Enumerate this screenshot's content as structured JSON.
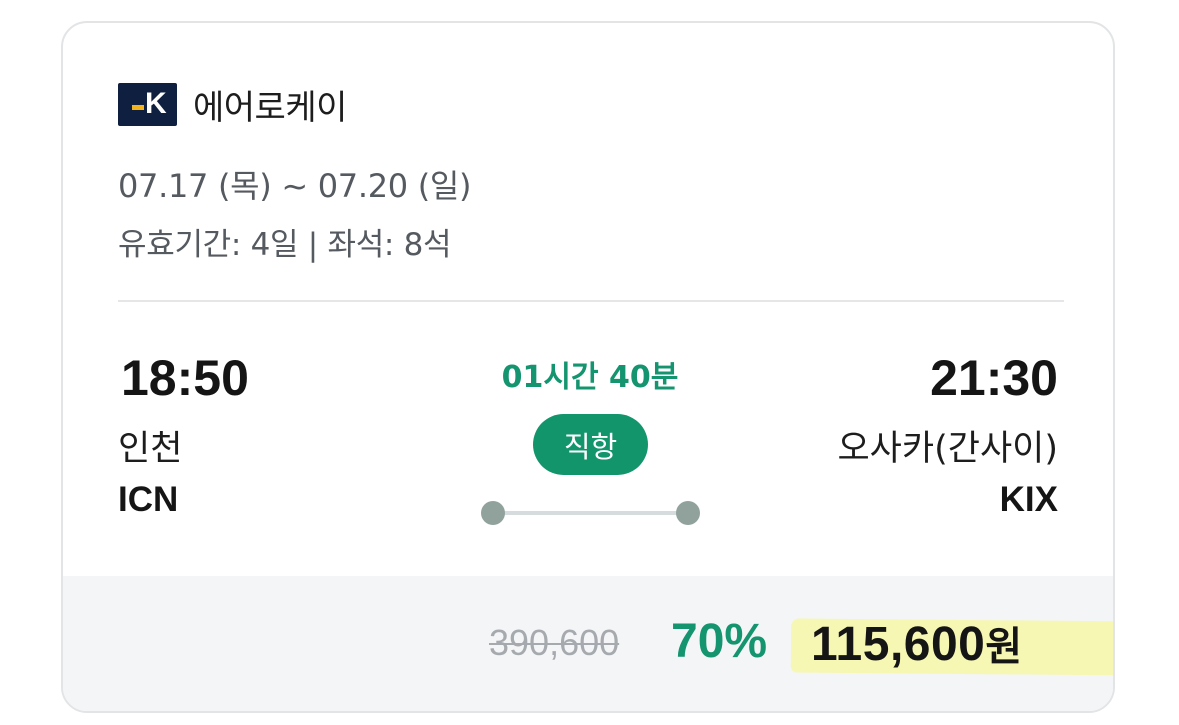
{
  "airline": {
    "logo_text": "K",
    "name": "에어로케이",
    "logo_colors": {
      "background": "#0f1f3f",
      "accent": "#f3b41b"
    }
  },
  "trip": {
    "dates": "07.17 (목) ~ 07.20 (일)",
    "validity": "유효기간: 4일 | 좌석: 8석"
  },
  "flight": {
    "departure": {
      "time": "18:50",
      "city": "인천",
      "code": "ICN"
    },
    "arrival": {
      "time": "21:30",
      "city": "오사카(간사이)",
      "code": "KIX"
    },
    "duration": "01시간 40분",
    "type_label": "직항"
  },
  "price": {
    "original": "390,600",
    "discount": "70%",
    "final_amount": "115,600",
    "currency": "원"
  },
  "colors": {
    "accent_green": "#14946f",
    "highlight": "#f6f7b2",
    "price_bg": "#f4f5f6"
  }
}
